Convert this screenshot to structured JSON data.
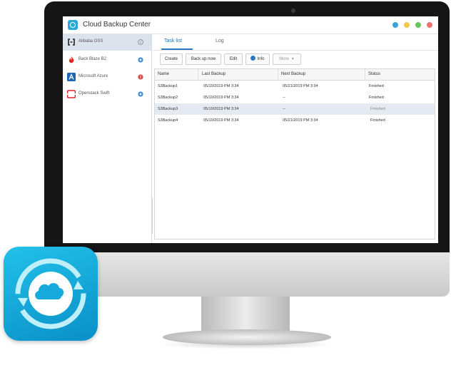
{
  "app": {
    "title": "Cloud Backup Center",
    "window_controls": [
      "#36a3dd",
      "#f3c845",
      "#62c65d",
      "#f06f6f"
    ]
  },
  "sidebar": {
    "items": [
      {
        "label": "Alibaba OSS",
        "status": "info",
        "selected": true
      },
      {
        "label": "Back Blaze B2",
        "status": "ok",
        "selected": false
      },
      {
        "label": "Microsoft Azure",
        "status": "error",
        "selected": false
      },
      {
        "label": "Openstack Swift",
        "status": "ok",
        "selected": false
      }
    ],
    "footer": {
      "add_label": "+"
    }
  },
  "main": {
    "tabs": [
      {
        "label": "Task list",
        "active": true
      },
      {
        "label": "Log",
        "active": false
      }
    ],
    "toolbar": {
      "create": "Create",
      "backup_now": "Back up now",
      "edit": "Edit",
      "info": "Info",
      "more": "More"
    },
    "table": {
      "headers": [
        "Name",
        "Last Backup",
        "Next Backup",
        "Status"
      ],
      "rows": [
        {
          "name": "S3Backup1",
          "last": "05/10/2019 PM 3:34",
          "next": "05/21/2019 PM 3:34",
          "status": "Finished",
          "selected": false
        },
        {
          "name": "S3Backup2",
          "last": "05/10/2019 PM 3:34",
          "next": "--",
          "status": "Finished",
          "selected": false
        },
        {
          "name": "S3Backup3",
          "last": "05/10/2019 PM 3:34",
          "next": "--",
          "status": "Finished",
          "selected": true
        },
        {
          "name": "S3Backup4",
          "last": "05/10/2019 PM 3:34",
          "next": "05/21/2019 PM 3:34",
          "status": "Finished",
          "selected": false
        }
      ]
    }
  },
  "colors": {
    "accent": "#2a78c4",
    "icon_gradient_top": "#22c1ea",
    "icon_gradient_bottom": "#0a8fc7"
  }
}
